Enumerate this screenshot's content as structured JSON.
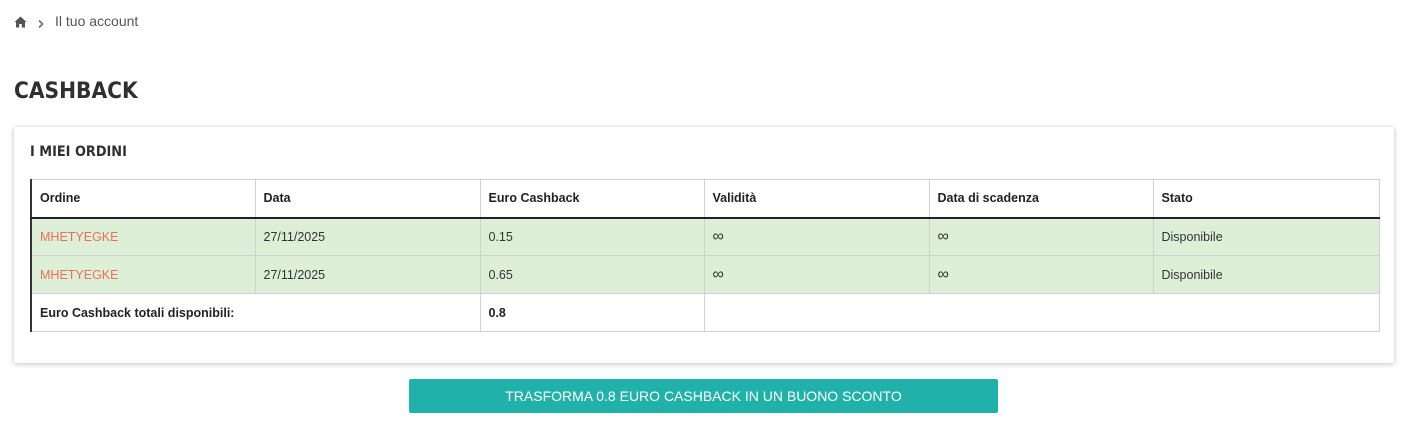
{
  "breadcrumb": {
    "home_icon": "home-icon",
    "separator_icon": "chevron-right-icon",
    "current": "Il tuo account"
  },
  "page": {
    "title": "CASHBACK"
  },
  "orders_card": {
    "title": "I MIEI ORDINI",
    "columns": [
      "Ordine",
      "Data",
      "Euro Cashback",
      "Validità",
      "Data di scadenza",
      "Stato"
    ],
    "rows": [
      {
        "ordine": "MHETYEGKE",
        "data": "27/11/2025",
        "euro_cashback": "0.15",
        "validita": "∞",
        "scadenza": "∞",
        "stato": "Disponibile"
      },
      {
        "ordine": "MHETYEGKE",
        "data": "27/11/2025",
        "euro_cashback": "0.65",
        "validita": "∞",
        "scadenza": "∞",
        "stato": "Disponibile"
      }
    ],
    "total_label": "Euro Cashback totali disponibili:",
    "total_value": "0.8"
  },
  "actions": {
    "convert_label": "TRASFORMA 0.8 EURO CASHBACK IN UN BUONO SCONTO"
  },
  "colors": {
    "accent": "#20b2aa",
    "order_link": "#e8705a",
    "row_highlight": "#deefd8"
  }
}
